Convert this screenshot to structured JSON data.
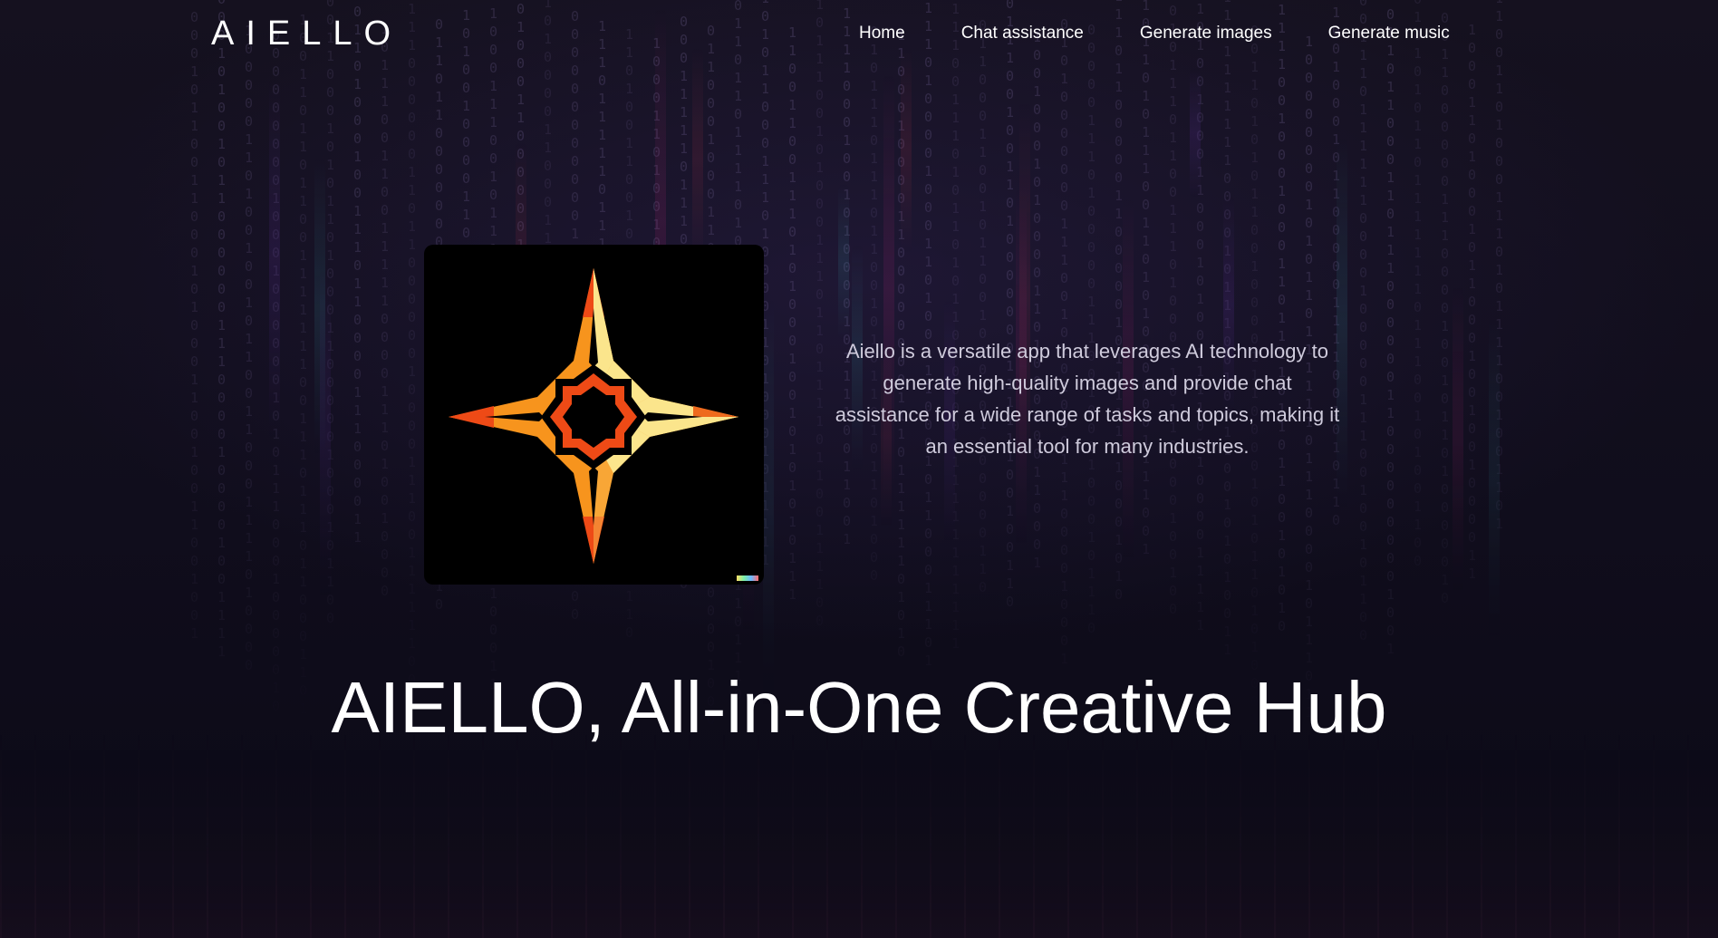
{
  "header": {
    "logo": "AIELLO",
    "nav": [
      {
        "label": "Home"
      },
      {
        "label": "Chat assistance"
      },
      {
        "label": "Generate images"
      },
      {
        "label": "Generate music"
      }
    ]
  },
  "hero": {
    "image_icon": "orange-four-point-star-logo",
    "description": "Aiello is a versatile app that leverages AI technology to generate high-quality images and provide chat assistance for a wide range of tasks and topics, making it an essential tool for many industries.",
    "headline": "AIELLO, All-in-One Creative Hub"
  },
  "colors": {
    "background": "#0d0b18",
    "text": "#ffffff",
    "muted_text": "#cfcbdc",
    "star_orange": "#f7941d",
    "star_red": "#ee4a16",
    "star_yellow": "#fbe58c"
  }
}
